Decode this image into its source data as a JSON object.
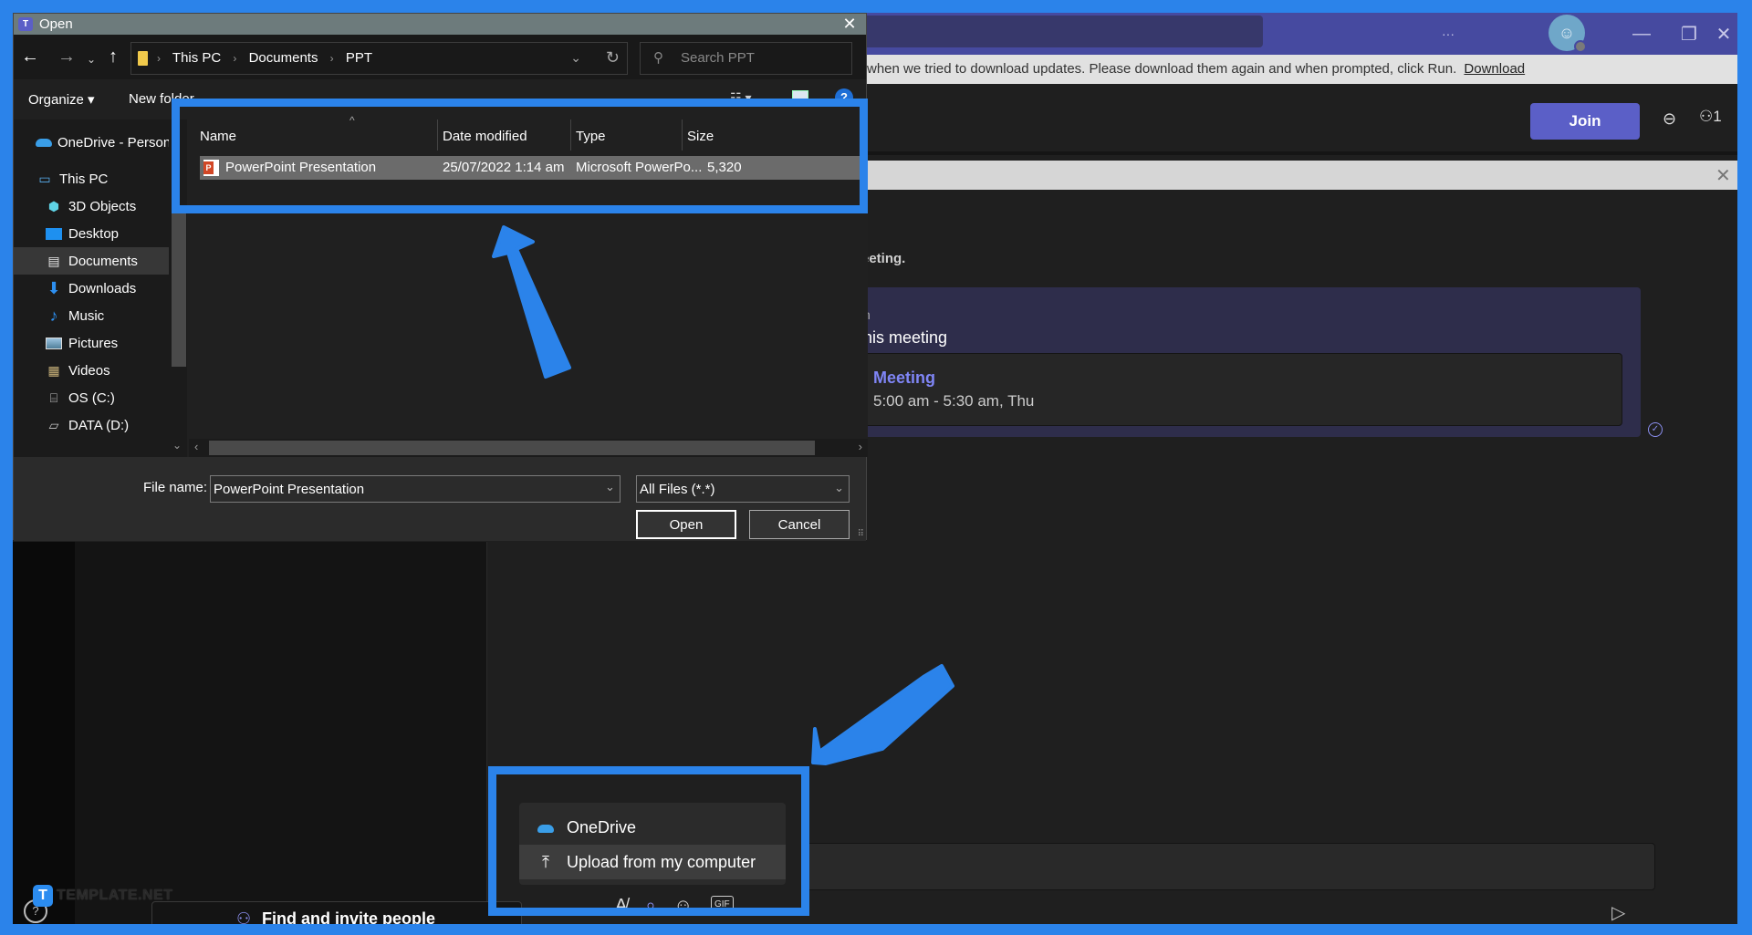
{
  "teams": {
    "window_controls": {
      "more": "···",
      "minimize": "—",
      "restore": "❐",
      "close": "✕"
    },
    "notice": {
      "text": "when we tried to download updates. Please download them again and when prompted, click Run.",
      "link": "Download"
    },
    "header": {
      "join_label": "Join",
      "participants_count": "1"
    },
    "chat": {
      "intro_text": "eeting.",
      "card": {
        "sender_fragment": "n",
        "title_fragment": "his meeting",
        "meeting_name": "Meeting",
        "meeting_time": "5:00 am - 5:30 am, Thu"
      }
    },
    "attach_menu": {
      "items": [
        {
          "icon": "onedrive-icon",
          "label": "OneDrive"
        },
        {
          "icon": "upload-icon",
          "label": "Upload from my computer"
        }
      ]
    },
    "compose_tools": [
      "format-icon",
      "attach-icon",
      "emoji-icon",
      "gif-icon"
    ],
    "gif_label": "GIF",
    "left_pane": {
      "find_people_label": "Find and invite people",
      "help_label": "Help"
    },
    "watermark": {
      "logo": "T",
      "text": "TEMPLATE.NET"
    }
  },
  "dialog": {
    "title": "Open",
    "app_icon_letter": "T",
    "breadcrumb": [
      "This PC",
      "Documents",
      "PPT"
    ],
    "search_placeholder": "Search PPT",
    "toolbar": {
      "organize": "Organize ▾",
      "new_folder": "New folder"
    },
    "nav_pane": [
      {
        "label": "OneDrive - Person",
        "icon": "onedrive-icon",
        "indent": 0
      },
      {
        "label": "This PC",
        "icon": "computer-icon",
        "indent": 0
      },
      {
        "label": "3D Objects",
        "icon": "cube-icon",
        "indent": 1
      },
      {
        "label": "Desktop",
        "icon": "desktop-icon",
        "indent": 1
      },
      {
        "label": "Documents",
        "icon": "document-icon",
        "indent": 1,
        "selected": true
      },
      {
        "label": "Downloads",
        "icon": "download-icon",
        "indent": 1
      },
      {
        "label": "Music",
        "icon": "music-icon",
        "indent": 1
      },
      {
        "label": "Pictures",
        "icon": "pictures-icon",
        "indent": 1
      },
      {
        "label": "Videos",
        "icon": "videos-icon",
        "indent": 1
      },
      {
        "label": "OS (C:)",
        "icon": "drive-icon",
        "indent": 1
      },
      {
        "label": "DATA (D:)",
        "icon": "drive-icon",
        "indent": 1
      }
    ],
    "columns": [
      "Name",
      "Date modified",
      "Type",
      "Size"
    ],
    "files": [
      {
        "name": "PowerPoint Presentation",
        "date_modified": "25/07/2022 1:14 am",
        "type": "Microsoft PowerPo...",
        "size": "5,320"
      }
    ],
    "footer": {
      "file_name_label": "File name:",
      "file_name_value": "PowerPoint Presentation",
      "file_type_value": "All Files (*.*)",
      "open_label": "Open",
      "cancel_label": "Cancel"
    }
  },
  "annotation": {
    "color": "#2b83ea"
  }
}
